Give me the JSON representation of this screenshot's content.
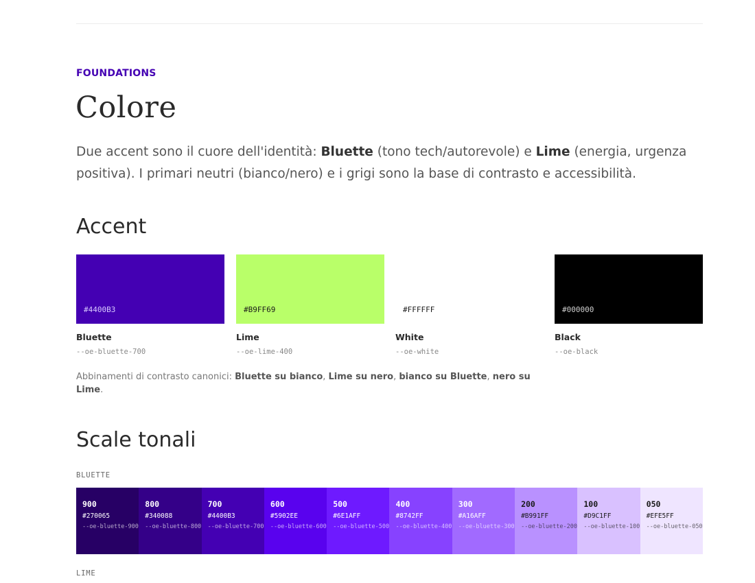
{
  "header": {
    "eyebrow": "FOUNDATIONS",
    "title": "Colore"
  },
  "intro": {
    "p1": "Due accent sono il cuore dell'identità: ",
    "bluette": "Bluette",
    "p2": " (tono tech/autorevole) e ",
    "lime": "Lime",
    "p3": " (energia, urgenza positiva). I primari neutri (bianco/nero) e i grigi sono la base di contrasto e accessibilità."
  },
  "accent": {
    "heading": "Accent",
    "swatches": [
      {
        "name": "Bluette",
        "hex": "#4400B3",
        "token": "--oe-bluette-700",
        "color": "#4400B3",
        "text_color": "#d8c8ff"
      },
      {
        "name": "Lime",
        "hex": "#B9FF69",
        "token": "--oe-lime-400",
        "color": "#B9FF69",
        "text_color": "#1a1a1a"
      },
      {
        "name": "White",
        "hex": "#FFFFFF",
        "token": "--oe-white",
        "color": "#FFFFFF",
        "text_color": "#1a1a1a"
      },
      {
        "name": "Black",
        "hex": "#000000",
        "token": "--oe-black",
        "color": "#000000",
        "text_color": "#d0d0d0"
      }
    ],
    "contrast": {
      "prefix": "Abbinamenti di contrasto canonici: ",
      "a": "Bluette su bianco",
      "sep1": ", ",
      "b": "Lime su nero",
      "sep2": ", ",
      "c": "bianco su Bluette",
      "sep3": ", ",
      "d": "nero su Lime",
      "suffix": "."
    }
  },
  "scales": {
    "heading": "Scale tonali",
    "bluette_label": "BLUETTE",
    "lime_label": "LIME",
    "bluette": [
      {
        "level": "900",
        "hex": "#270065",
        "token": "--oe-bluette-900",
        "color": "#270065",
        "text_color": "#ffffff"
      },
      {
        "level": "800",
        "hex": "#340088",
        "token": "--oe-bluette-800",
        "color": "#340088",
        "text_color": "#ffffff"
      },
      {
        "level": "700",
        "hex": "#4400B3",
        "token": "--oe-bluette-700",
        "color": "#4400B3",
        "text_color": "#ffffff"
      },
      {
        "level": "600",
        "hex": "#5902EE",
        "token": "--oe-bluette-600",
        "color": "#5902EE",
        "text_color": "#ffffff"
      },
      {
        "level": "500",
        "hex": "#6E1AFF",
        "token": "--oe-bluette-500",
        "color": "#6E1AFF",
        "text_color": "#ffffff"
      },
      {
        "level": "400",
        "hex": "#8742FF",
        "token": "--oe-bluette-400",
        "color": "#8742FF",
        "text_color": "#ffffff"
      },
      {
        "level": "300",
        "hex": "#A16AFF",
        "token": "--oe-bluette-300",
        "color": "#A16AFF",
        "text_color": "#ffffff"
      },
      {
        "level": "200",
        "hex": "#B991FF",
        "token": "--oe-bluette-200",
        "color": "#B991FF",
        "text_color": "#1a1a1a"
      },
      {
        "level": "100",
        "hex": "#D9C1FF",
        "token": "--oe-bluette-100",
        "color": "#D9C1FF",
        "text_color": "#1a1a1a"
      },
      {
        "level": "050",
        "hex": "#EFE5FF",
        "token": "--oe-bluette-050",
        "color": "#EFE5FF",
        "text_color": "#1a1a1a"
      }
    ]
  }
}
